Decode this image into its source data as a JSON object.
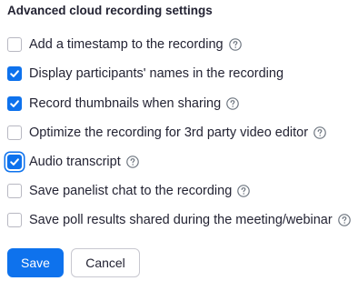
{
  "section": {
    "title": "Advanced cloud recording settings"
  },
  "options": [
    {
      "label": "Add a timestamp to the recording",
      "checked": false,
      "help_icon": "question-circle-icon"
    },
    {
      "label": "Display participants' names in the recording",
      "checked": true,
      "help_icon": null
    },
    {
      "label": "Record thumbnails when sharing",
      "checked": true,
      "help_icon": "question-circle-icon"
    },
    {
      "label": "Optimize the recording for 3rd party video editor",
      "checked": false,
      "help_icon": "question-circle-icon"
    },
    {
      "label": "Audio transcript",
      "checked": true,
      "focused": true,
      "help_icon": "question-circle-icon"
    },
    {
      "label": "Save panelist chat to the recording",
      "checked": false,
      "help_icon": "question-circle-icon"
    },
    {
      "label": "Save poll results shared during the meeting/webinar",
      "checked": false,
      "help_icon": "question-circle-icon"
    }
  ],
  "actions": {
    "save_label": "Save",
    "cancel_label": "Cancel"
  },
  "colors": {
    "accent": "#0e72ed",
    "text": "#232333",
    "checkbox_border": "#b8b8c2",
    "help_icon": "#6e7680"
  }
}
